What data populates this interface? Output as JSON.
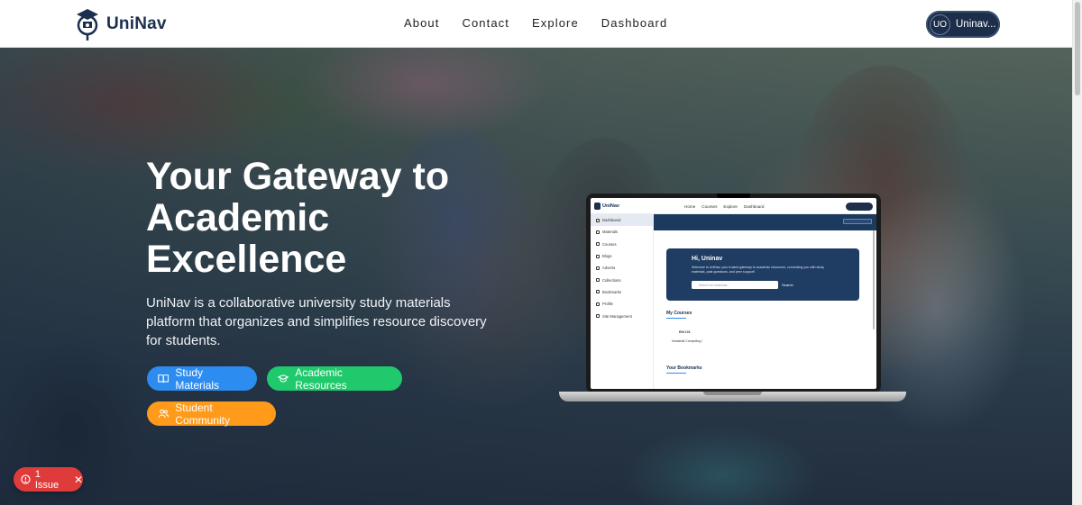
{
  "navbar": {
    "brand": "UniNav",
    "links": [
      "About",
      "Contact",
      "Explore",
      "Dashboard"
    ],
    "user_initials": "UO",
    "user_name": "Uninav..."
  },
  "hero": {
    "title": "Your Gateway to Academic Excellence",
    "description": "UniNav is a collaborative university study materials platform that organizes and simplifies resource discovery for students.",
    "buttons": {
      "study_materials": "Study Materials",
      "academic_resources": "Academic Resources",
      "student_community": "Student Community"
    }
  },
  "mockup": {
    "brand": "UniNav",
    "links": [
      "Home",
      "Courses",
      "Explore",
      "Dashboard"
    ],
    "sidebar": [
      "Dashboard",
      "Materials",
      "Courses",
      "Blogs",
      "Adverts",
      "Collections",
      "Bookmarks",
      "Profile",
      "Site Management"
    ],
    "greeting": "Hi, Uninav",
    "welcome": "Welcome to UniNav, your trusted gateway to academic resources, connecting you with study materials, past questions, and peer support!",
    "search_placeholder": "Search for materials...",
    "search_button": "Search",
    "my_courses": "My Courses",
    "course_code": "ENI 101",
    "course_name": "Industrial Computing I",
    "your_bookmarks": "Your Bookmarks"
  },
  "issue_badge": {
    "label": "1 Issue"
  },
  "colors": {
    "navy": "#1c2e4a",
    "blue_pill": "#2d8cf0",
    "green_pill": "#1fc96c",
    "orange_pill": "#ff9a1a",
    "issue_red": "#e03b3b"
  }
}
